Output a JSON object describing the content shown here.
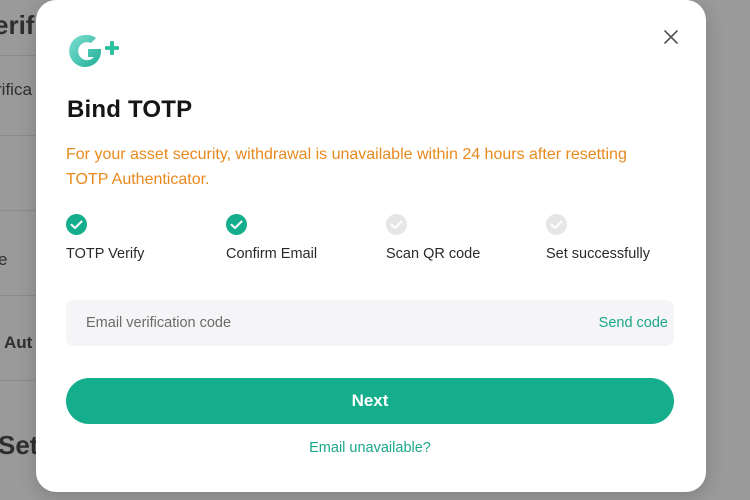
{
  "background": {
    "fragments": [
      "erifi",
      "rifica",
      "e",
      "Aut",
      "Set"
    ]
  },
  "modal": {
    "title": "Bind TOTP",
    "warning": "For your asset security, withdrawal is unavailable within 24 hours after resetting TOTP Authenticator.",
    "steps": [
      {
        "label": "TOTP Verify",
        "status": "done"
      },
      {
        "label": "Confirm Email",
        "status": "done"
      },
      {
        "label": "Scan QR code",
        "status": "pending"
      },
      {
        "label": "Set successfully",
        "status": "pending"
      }
    ],
    "code_field": {
      "placeholder": "Email verification code",
      "value": "",
      "send_label": "Send code"
    },
    "next_label": "Next",
    "unavailable_link": "Email unavailable?"
  },
  "colors": {
    "accent": "#15ae8d",
    "warning": "#e8891d",
    "step_done": "#15ae8d",
    "step_pending": "#e6e6e6"
  },
  "icons": {
    "logo": "g-plus-logo",
    "close": "close-icon",
    "step_done": "check-circle-icon",
    "step_pending": "check-circle-inactive-icon"
  }
}
